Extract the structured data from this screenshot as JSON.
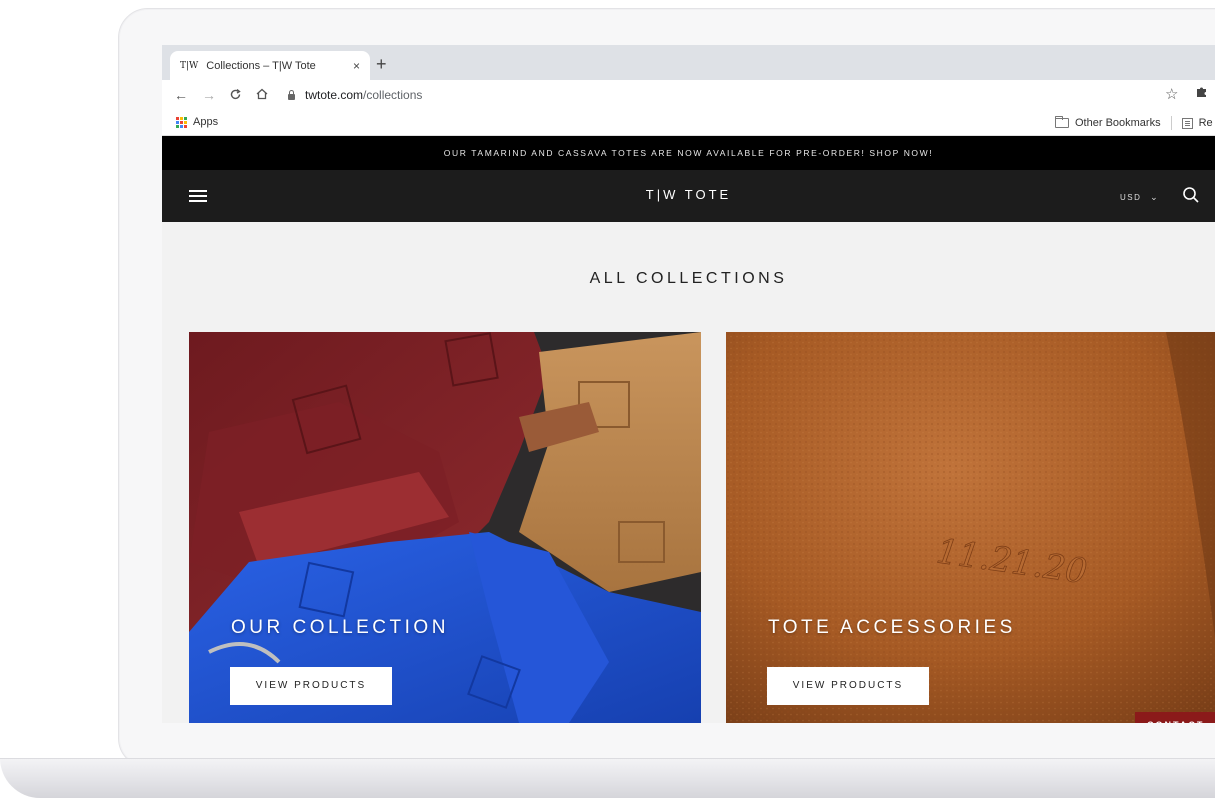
{
  "browser": {
    "tab_favicon": "T|W",
    "tab_title": "Collections – T|W Tote",
    "tab_close": "×",
    "new_tab": "+",
    "url_host": "twtote.com",
    "url_path": "/collections",
    "bookmarks": {
      "apps_label": "Apps",
      "other_bookmarks": "Other Bookmarks",
      "reading_list": "Re"
    },
    "apps_colors": [
      "#ea4335",
      "#fbbc05",
      "#34a853",
      "#4285f4",
      "#ea4335",
      "#fbbc05",
      "#34a853",
      "#4285f4",
      "#ea4335"
    ]
  },
  "site": {
    "announcement": "OUR TAMARIND AND CASSAVA TOTES ARE NOW AVAILABLE FOR PRE-ORDER! SHOP NOW!",
    "logo": "T|W TOTE",
    "currency": "USD",
    "page_title": "ALL COLLECTIONS",
    "collections": [
      {
        "title": "OUR COLLECTION",
        "button": "VIEW PRODUCTS",
        "image": "colorful-tote-bags-photo"
      },
      {
        "title": "TOTE ACCESSORIES",
        "button": "VIEW PRODUCTS",
        "image": "embossed-leather-photo",
        "emboss_text": "11.21.20"
      }
    ],
    "contact_label": "CONTACT"
  },
  "colors": {
    "announcement_bg": "#000000",
    "header_bg": "#1c1c1c",
    "page_bg": "#f2f2f2",
    "contact_bg": "#8b1a1a"
  }
}
